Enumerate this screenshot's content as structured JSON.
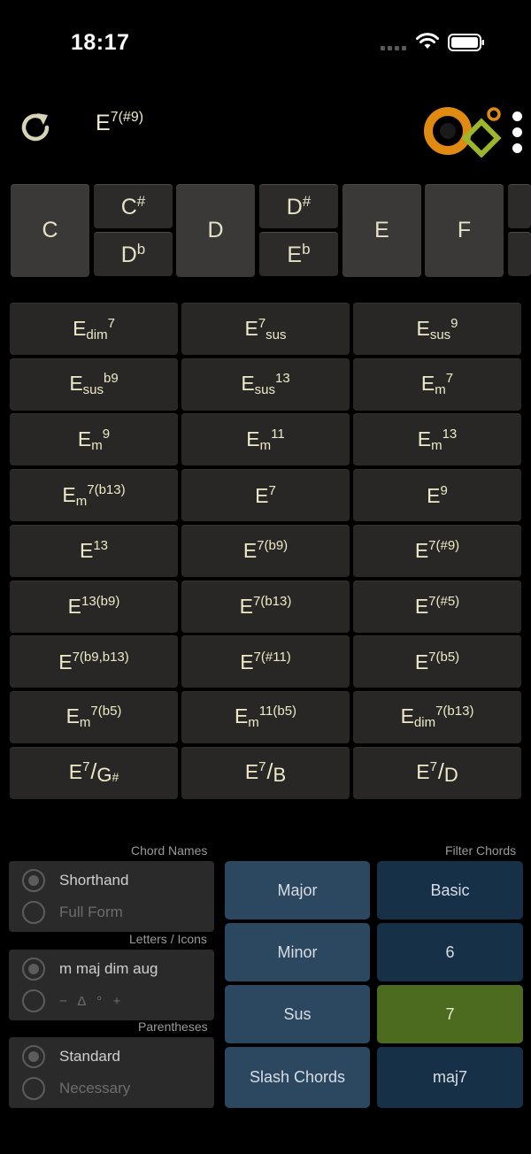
{
  "status_bar": {
    "time": "18:17"
  },
  "header": {
    "current_chord": {
      "root": "E",
      "ext": "7(#9)"
    },
    "icons": {
      "refresh": "refresh-icon",
      "logo": "app-logo",
      "menu": "more-vertical-icon"
    }
  },
  "keys": {
    "naturals": [
      {
        "id": "c",
        "label": "C"
      },
      {
        "id": "d",
        "label": "D"
      },
      {
        "id": "e",
        "label": "E"
      },
      {
        "id": "f",
        "label": "F"
      }
    ],
    "accidentals": [
      {
        "id": "csharp",
        "note": "C",
        "acc": "#"
      },
      {
        "id": "dflat",
        "note": "D",
        "acc": "b"
      },
      {
        "id": "dsharp",
        "note": "D",
        "acc": "#"
      },
      {
        "id": "eflat",
        "note": "E",
        "acc": "b"
      }
    ]
  },
  "chords": [
    {
      "root": "E",
      "sub": "dim",
      "sup": "7"
    },
    {
      "root": "E",
      "sup": "7",
      "sub": "sus"
    },
    {
      "root": "E",
      "sub": "sus",
      "sup": "9"
    },
    {
      "root": "E",
      "sub": "sus",
      "sup": "b9"
    },
    {
      "root": "E",
      "sub": "sus",
      "sup": "13"
    },
    {
      "root": "E",
      "sub": "m",
      "sup": "7"
    },
    {
      "root": "E",
      "sub": "m",
      "sup": "9"
    },
    {
      "root": "E",
      "sub": "m",
      "sup": "11"
    },
    {
      "root": "E",
      "sub": "m",
      "sup": "13"
    },
    {
      "root": "E",
      "sub": "m",
      "sup": "7(b13)"
    },
    {
      "root": "E",
      "sup": "7"
    },
    {
      "root": "E",
      "sup": "9"
    },
    {
      "root": "E",
      "sup": "13"
    },
    {
      "root": "E",
      "sup": "7(b9)"
    },
    {
      "root": "E",
      "sup": "7(#9)"
    },
    {
      "root": "E",
      "sup": "13(b9)"
    },
    {
      "root": "E",
      "sup": "7(b13)"
    },
    {
      "root": "E",
      "sup": "7(#5)"
    },
    {
      "root": "E",
      "sup": "7(b9,b13)"
    },
    {
      "root": "E",
      "sup": "7(#11)"
    },
    {
      "root": "E",
      "sup": "7(b5)"
    },
    {
      "root": "E",
      "sub": "m",
      "sup": "7(b5)"
    },
    {
      "root": "E",
      "sub": "m",
      "sup": "11(b5)"
    },
    {
      "root": "E",
      "sub": "dim",
      "sup": "7(b13)"
    },
    {
      "root": "E",
      "sup": "7",
      "slash": "/",
      "bass": "G",
      "bass_acc": "#"
    },
    {
      "root": "E",
      "sup": "7",
      "slash": "/",
      "bass": "B"
    },
    {
      "root": "E",
      "sup": "7",
      "slash": "/",
      "bass": "D"
    }
  ],
  "settings": {
    "chord_names": {
      "title": "Chord Names",
      "options": [
        {
          "label": "Shorthand",
          "selected": true
        },
        {
          "label": "Full Form",
          "selected": false
        }
      ]
    },
    "letters_icons": {
      "title": "Letters / Icons",
      "options": [
        {
          "label": "m maj dim aug",
          "selected": true
        },
        {
          "label": "−   Δ   °   +",
          "selected": false
        }
      ]
    },
    "parentheses": {
      "title": "Parentheses",
      "options": [
        {
          "label": "Standard",
          "selected": true
        },
        {
          "label": "Necessary",
          "selected": false
        }
      ]
    }
  },
  "filters": {
    "title": "Filter Chords",
    "left": [
      "Major",
      "Minor",
      "Sus",
      "Slash Chords"
    ],
    "right": [
      "Basic",
      "6",
      "7",
      "maj7"
    ],
    "active_right_index": 2,
    "colors": {
      "left": "#2b4860",
      "right": "#163048",
      "active": "#4d6b1e"
    }
  }
}
